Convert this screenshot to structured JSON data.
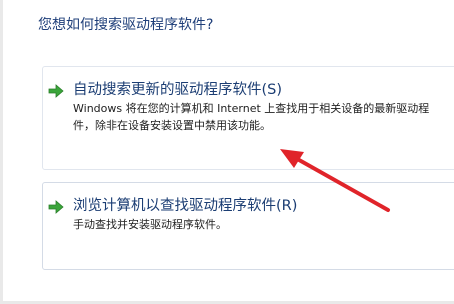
{
  "question": "您想如何搜索驱动程序软件?",
  "options": [
    {
      "title": "自动搜索更新的驱动程序软件(S)",
      "desc_line1": "Windows 将在您的计算机和 Internet 上查找用于相关设备的最新驱动程",
      "desc_line2": "件，除非在设备安装设置中禁用该功能。",
      "icon": "green-arrow-icon"
    },
    {
      "title": "浏览计算机以查找驱动程序软件(R)",
      "desc_line1": "手动查找并安装驱动程序软件。",
      "icon": "green-arrow-icon"
    }
  ],
  "colors": {
    "title": "#1b3d73",
    "question": "#1f3f7a",
    "arrow_green": "#3aa53a",
    "annotation_red": "#e0242a"
  }
}
